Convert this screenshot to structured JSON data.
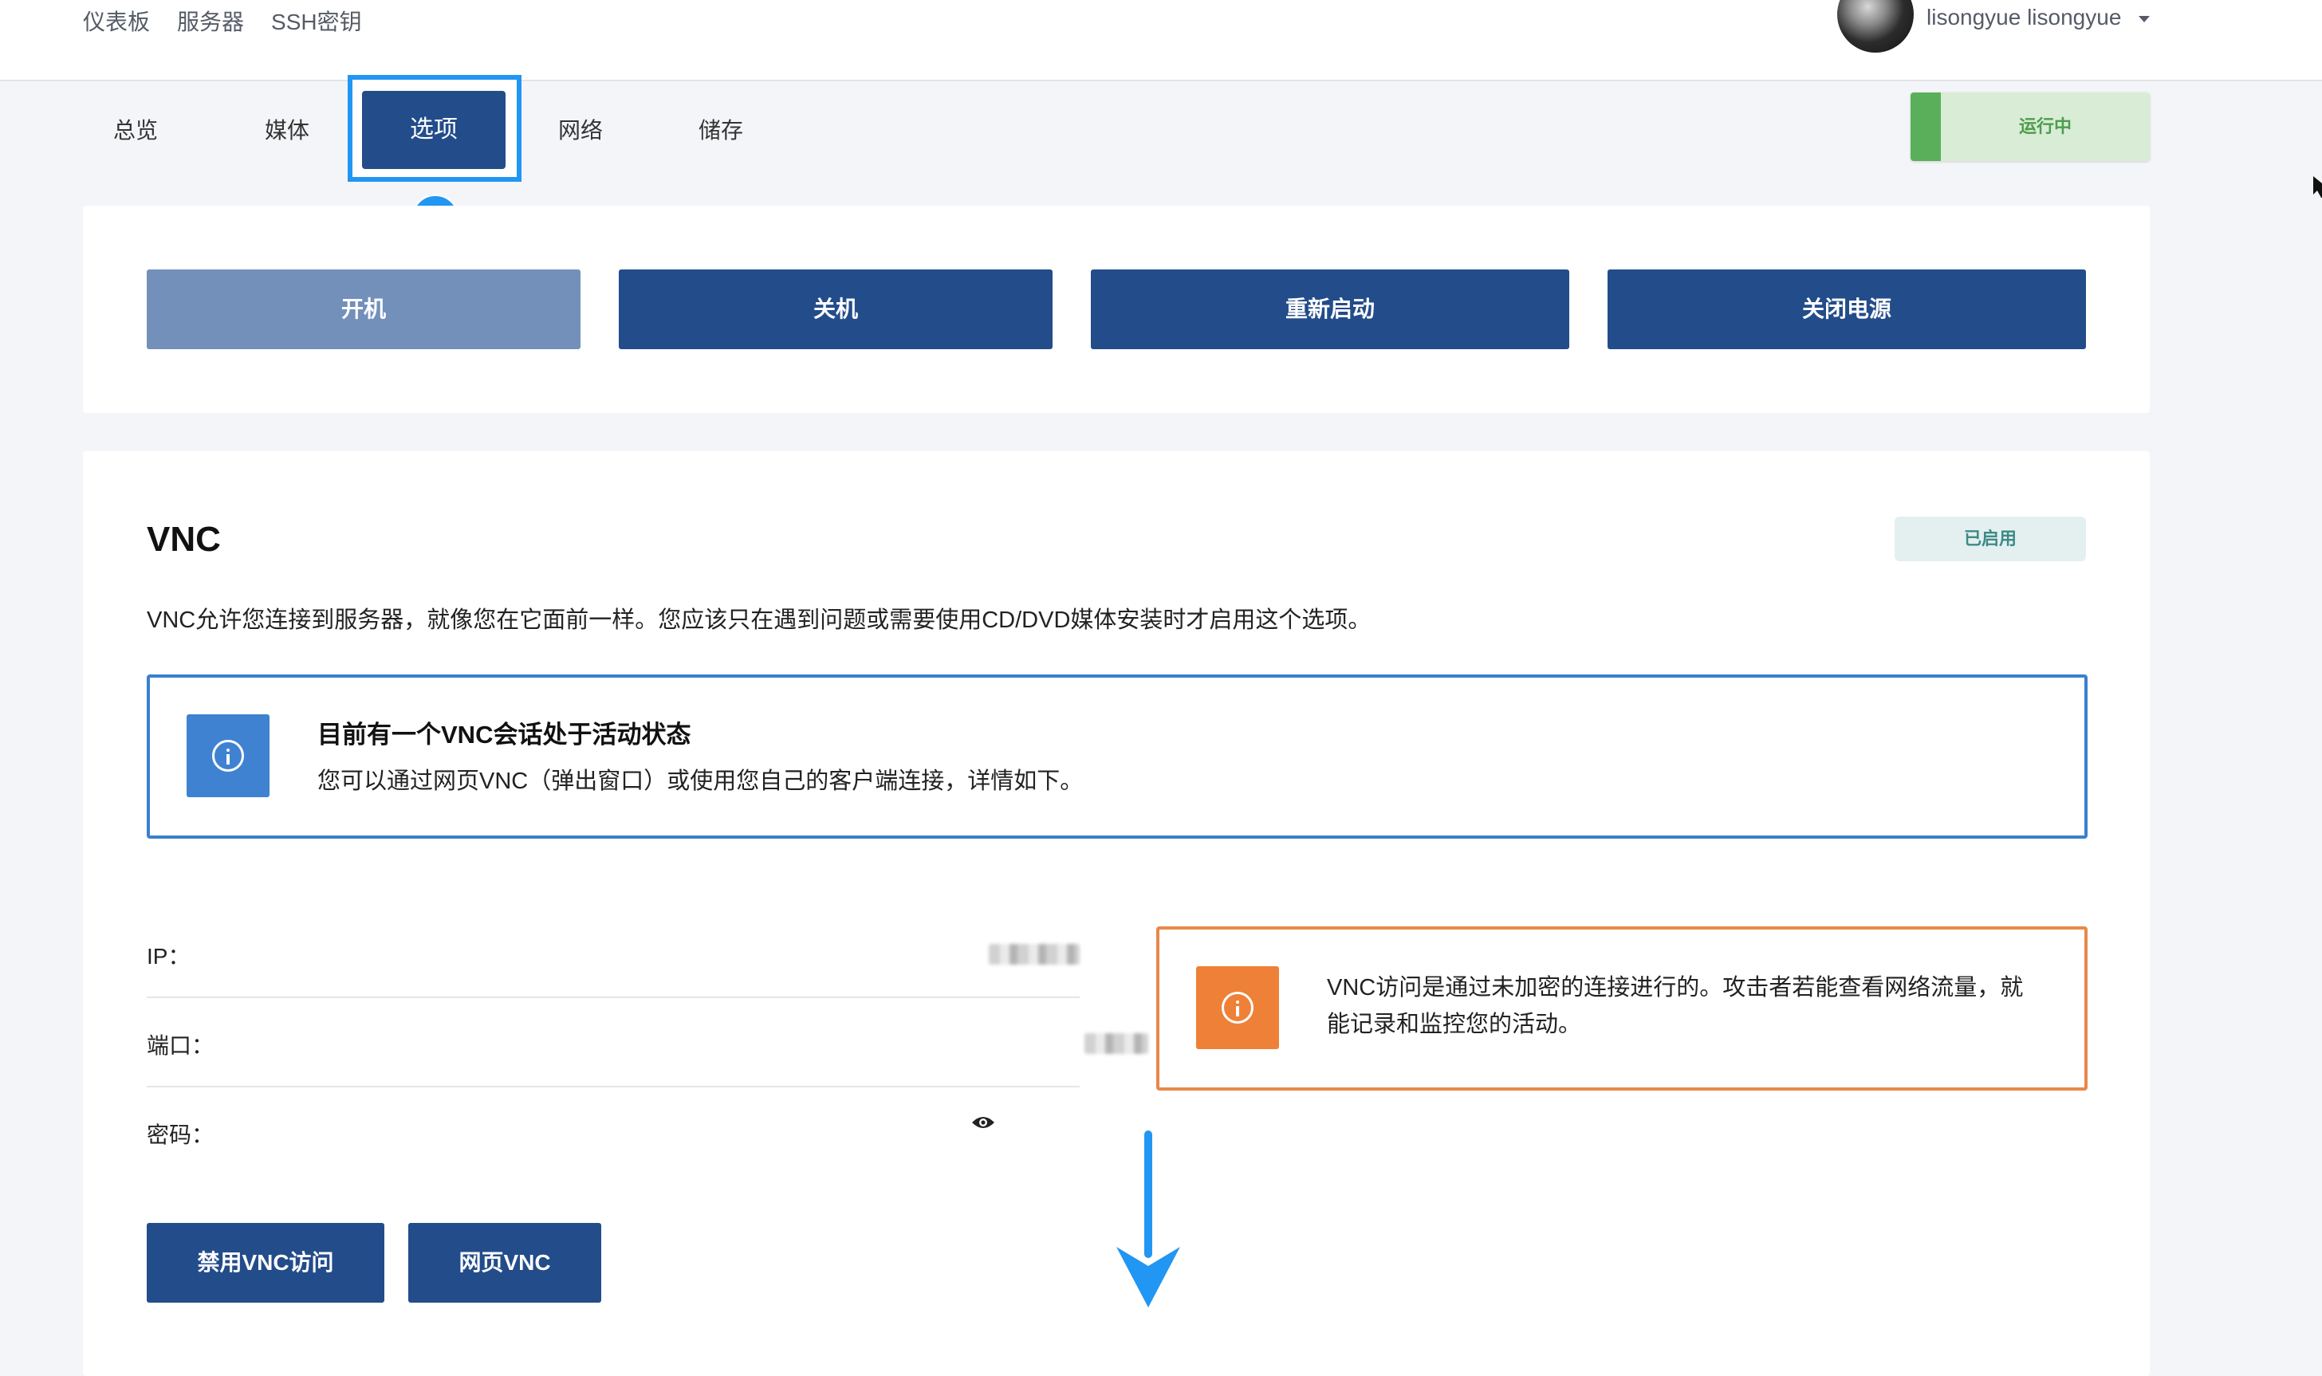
{
  "topnav": {
    "items": [
      "仪表板",
      "服务器",
      "SSH密钥"
    ]
  },
  "user": {
    "name": "lisongyue lisongyue"
  },
  "tabs": {
    "items": [
      "总览",
      "媒体",
      "选项",
      "网络",
      "储存"
    ],
    "active_index": 2
  },
  "annotation": {
    "step": "1"
  },
  "status": {
    "label": "运行中",
    "color": "#5ab05a"
  },
  "power": {
    "buttons": [
      "开机",
      "关机",
      "重新启动",
      "关闭电源"
    ],
    "disabled": [
      "开机"
    ]
  },
  "vnc": {
    "title": "VNC",
    "state_badge": "已启用",
    "description": "VNC允许您连接到服务器，就像您在它面前一样。您应该只在遇到问题或需要使用CD/DVD媒体安装时才启用这个选项。",
    "session_info": {
      "title": "目前有一个VNC会话处于活动状态",
      "text": "您可以通过网页VNC（弹出窗口）或使用您自己的客户端连接，详情如下。"
    },
    "fields": [
      {
        "label": "IP："
      },
      {
        "label": "端口："
      },
      {
        "label": "密码："
      }
    ],
    "warning": "VNC访问是通过未加密的连接进行的。攻击者若能查看网络流量，就能记录和监控您的活动。",
    "actions": [
      "禁用VNC访问",
      "网页VNC"
    ]
  },
  "colors": {
    "primary": "#234c8a",
    "primary_disabled": "#7390bb",
    "info": "#3f82d1",
    "warning": "#ee8137",
    "highlight": "#2196f3"
  }
}
